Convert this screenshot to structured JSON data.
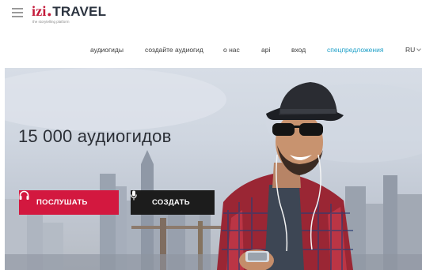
{
  "header": {
    "logo": {
      "izi": "izi",
      "dot": "●",
      "travel": "TRAVEL",
      "tagline": "the storytelling platform"
    },
    "nav": [
      {
        "label": "аудиогиды"
      },
      {
        "label": "создайте аудиогид"
      },
      {
        "label": "о нас"
      },
      {
        "label": "api"
      },
      {
        "label": "вход"
      },
      {
        "label": "спецпредложения"
      }
    ],
    "language": "RU"
  },
  "hero": {
    "title": "15 000 аудиогидов",
    "listen_button": "ПОСЛУШАТЬ",
    "create_button": "СОЗДАТЬ"
  },
  "colors": {
    "brand_red": "#d3183f",
    "accent_link": "#1fa0c8",
    "dark_button": "#1c1c1c"
  },
  "icons": {
    "menu": "hamburger-menu-icon",
    "listen": "headphones-icon",
    "create": "microphone-icon",
    "language": "chevron-down-icon"
  }
}
